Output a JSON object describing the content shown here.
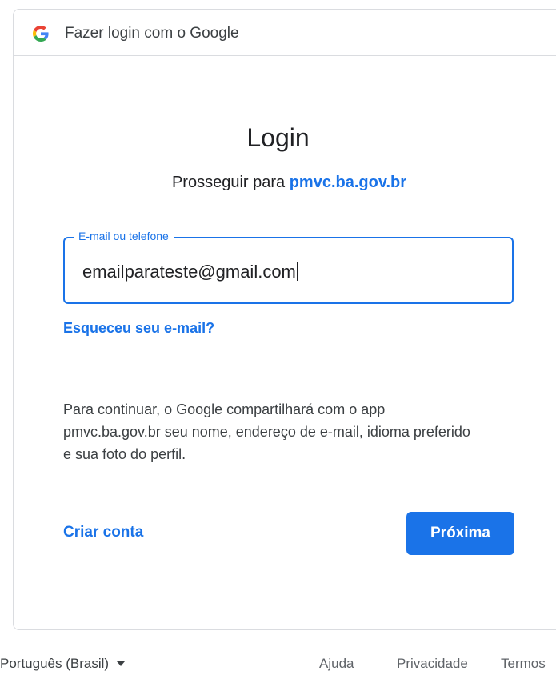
{
  "header": {
    "icon": "google-g-logo",
    "title": "Fazer login com o Google"
  },
  "main": {
    "title": "Login",
    "subtitle_prefix": "Prosseguir para ",
    "subtitle_domain": "pmvc.ba.gov.br",
    "email_field": {
      "label": "E-mail ou telefone",
      "value": "emailparateste@gmail.com"
    },
    "forgot_email_link": "Esqueceu seu e-mail?",
    "notice": "Para continuar, o Google compartilhará com o app pmvc.ba.gov.br seu nome, endereço de e-mail, idioma preferido e sua foto do perfil.",
    "create_account_link": "Criar conta",
    "next_button": "Próxima"
  },
  "footer": {
    "language": "Português (Brasil)",
    "help": "Ajuda",
    "privacy": "Privacidade",
    "terms": "Termos"
  },
  "colors": {
    "accent": "#1a73e8",
    "border": "#dadce0",
    "text": "#202124"
  }
}
